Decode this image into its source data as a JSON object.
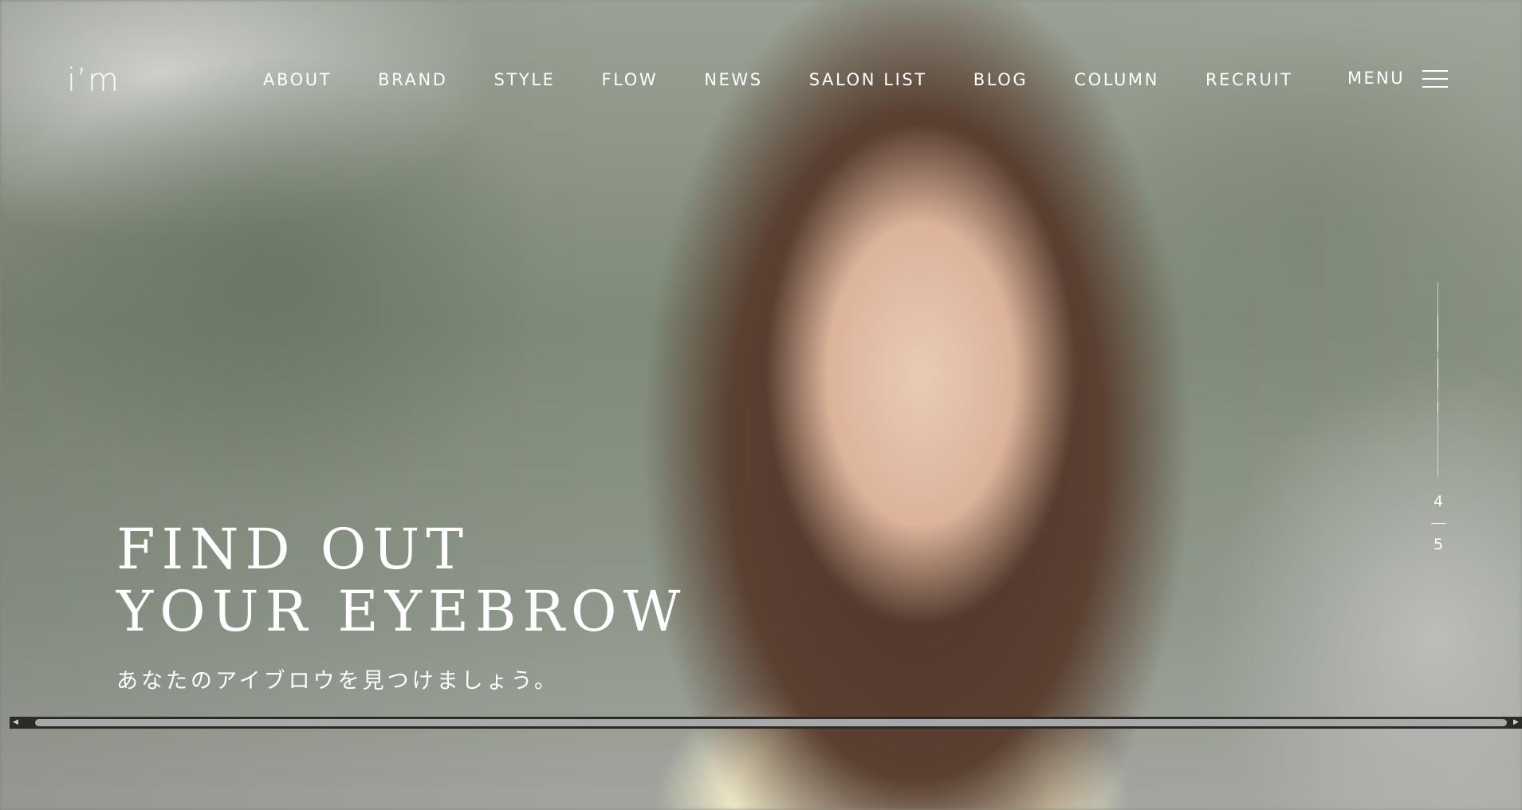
{
  "header": {
    "logo": "i’m",
    "nav": [
      {
        "label": "ABOUT"
      },
      {
        "label": "BRAND"
      },
      {
        "label": "STYLE"
      },
      {
        "label": "FLOW"
      },
      {
        "label": "NEWS"
      },
      {
        "label": "SALON LIST"
      },
      {
        "label": "BLOG"
      },
      {
        "label": "COLUMN"
      },
      {
        "label": "RECRUIT"
      }
    ],
    "menu_label": "MENU"
  },
  "hero": {
    "title_line1": "FIND OUT",
    "title_line2": "YOUR EYEBROW",
    "subtitle": "あなたのアイブロウを見つけましょう。"
  },
  "slider": {
    "current": "4",
    "total": "5"
  },
  "scrollbar": {
    "left_arrow_icon": "scroll-left-arrow-icon",
    "right_arrow_icon": "scroll-right-arrow-icon"
  },
  "colors": {
    "text": "#ffffff",
    "scrollbar_track": "#2b2b2b",
    "scrollbar_thumb": "#a9a9a9"
  }
}
